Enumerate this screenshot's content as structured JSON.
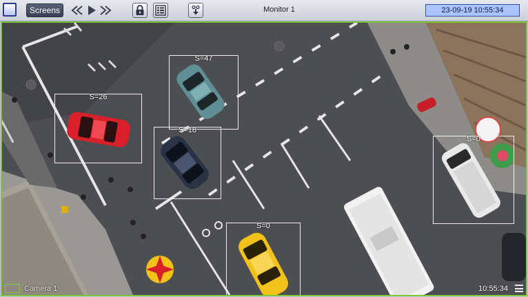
{
  "toolbar": {
    "screens_label": "Screens",
    "monitor_title": "Monitor 1",
    "clock": "23-09-19 10:55:34",
    "icons": [
      "layout-square-icon",
      "rewind-icon",
      "play-icon",
      "fast-forward-icon",
      "lock-icon",
      "list-icon",
      "download-icon"
    ]
  },
  "camera": {
    "name": "Camera 1",
    "time": "10:55:34",
    "detections": [
      {
        "id": "det-1",
        "label": "S=47"
      },
      {
        "id": "det-2",
        "label": "S=26"
      },
      {
        "id": "det-3",
        "label": "S=18"
      },
      {
        "id": "det-4",
        "label": "S=0"
      },
      {
        "id": "det-5",
        "label": "S=0"
      }
    ]
  },
  "colors": {
    "active_border": "#7cc83a",
    "clock_bg": "#a9c4ff",
    "taxi": "#f2c21a",
    "red_car": "#d8202a",
    "teal_car": "#5f8f94"
  }
}
